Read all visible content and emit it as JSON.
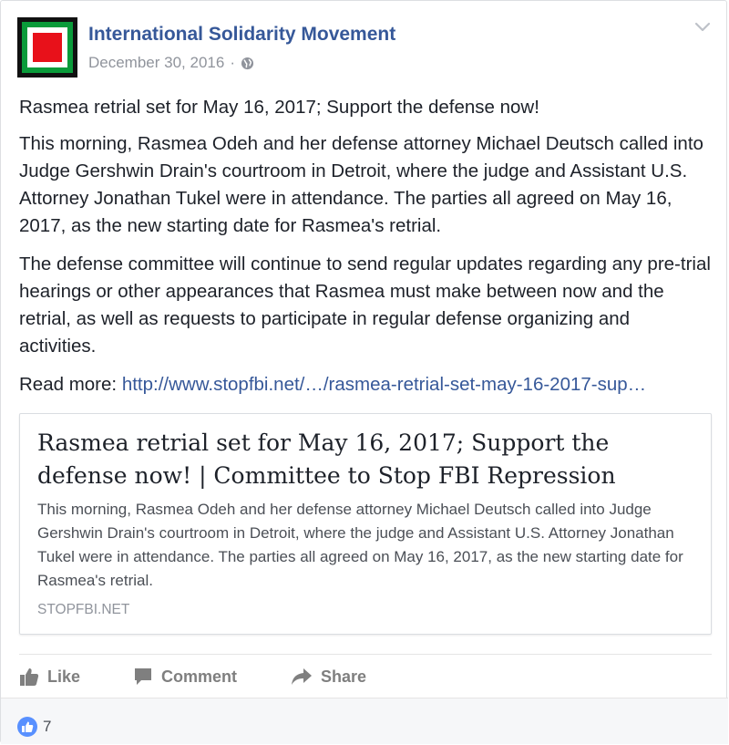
{
  "post": {
    "page_name": "International Solidarity Movement",
    "date": "December 30, 2016",
    "separator": "·",
    "privacy_icon": "globe-icon",
    "options_icon": "chevron-down-icon",
    "paragraphs": [
      "Rasmea retrial set for May 16, 2017; Support the defense now!",
      "This morning, Rasmea Odeh and her defense attorney Michael Deutsch called into Judge Gershwin Drain's courtroom in Detroit, where the judge and Assistant U.S. Attorney Jonathan Tukel were in attendance. The parties all agreed on May 16, 2017, as the new starting date for Rasmea's retrial.",
      "The defense committee will continue to send regular updates regarding any pre-trial hearings or other appearances that Rasmea must make between now and the retrial, as well as requests to participate in regular defense organizing and activities."
    ],
    "read_more_label": "Read more: ",
    "read_more_link": "http://www.stopfbi.net/…/rasmea-retrial-set-may-16-2017-sup…"
  },
  "link_card": {
    "title": "Rasmea retrial set for May 16, 2017; Support the defense now! | Committee to Stop FBI Repression",
    "description": "This morning, Rasmea Odeh and her defense attorney Michael Deutsch called into Judge Gershwin Drain's courtroom in Detroit, where the judge and Assistant U.S. Attorney Jonathan Tukel were in attendance. The parties all agreed on May 16, 2017, as the new starting date for Rasmea's retrial.",
    "domain": "STOPFBI.NET"
  },
  "actions": {
    "like_label": "Like",
    "like_icon": "thumbs-up-icon",
    "comment_label": "Comment",
    "comment_icon": "speech-bubble-icon",
    "share_label": "Share",
    "share_icon": "share-arrow-icon"
  },
  "reactions": {
    "icon": "like-reaction-icon",
    "count": "7"
  },
  "colors": {
    "link": "#365899",
    "text": "#1d2129",
    "muted": "#90949c",
    "action_gray": "#7f7f7f",
    "reaction_blue": "#5890ff",
    "avatar_green": "#0a9b3a",
    "avatar_red": "#e8111a"
  }
}
